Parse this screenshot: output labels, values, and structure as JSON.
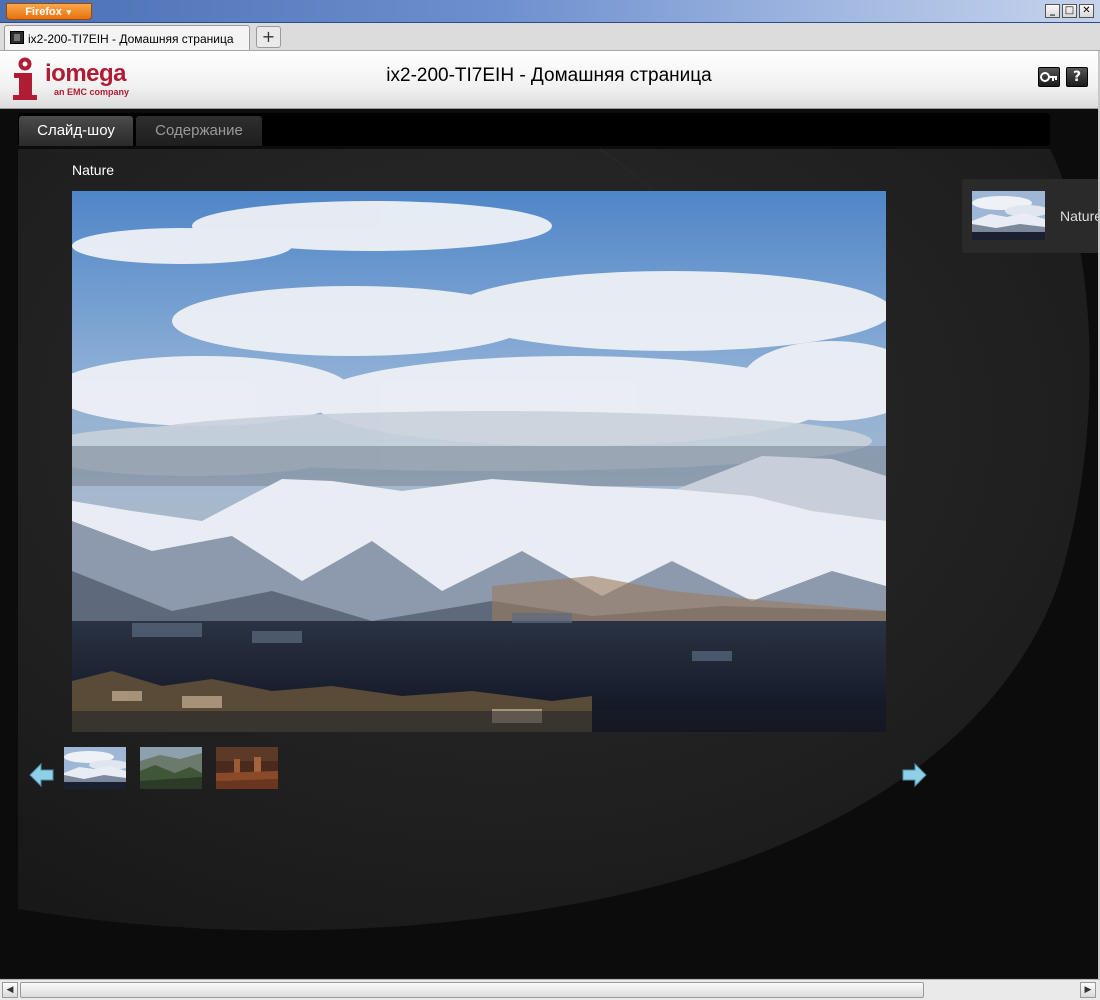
{
  "browser": {
    "menu_button_label": "Firefox",
    "tab_title": "ix2-200-TI7EIH - Домашняя страница",
    "new_tab_label": "+",
    "window_controls": {
      "minimize": "_",
      "maximize": "□",
      "close": "✕"
    }
  },
  "header": {
    "logo_text": "iomega",
    "logo_sub": "an EMC company",
    "title": "ix2-200-TI7EIH - Домашняя страница",
    "icons": [
      "key-icon",
      "help-icon"
    ],
    "help_label": "?"
  },
  "tabs": [
    {
      "label": "Слайд-шоу",
      "active": true
    },
    {
      "label": "Содержание",
      "active": false
    }
  ],
  "slideshow": {
    "album_title": "Nature",
    "main_image": "snowy-mountains-over-city",
    "thumbnails": [
      "snowy-mountains",
      "green-valley",
      "red-rock-canyon"
    ],
    "selected_thumbnail": 0
  },
  "albums": [
    {
      "label": "Nature"
    }
  ],
  "colors": {
    "brand_red": "#b01c33",
    "firefox_orange": "#e6720f",
    "content_bg": "#111111",
    "arrow_blue": "#7fc6e0"
  }
}
